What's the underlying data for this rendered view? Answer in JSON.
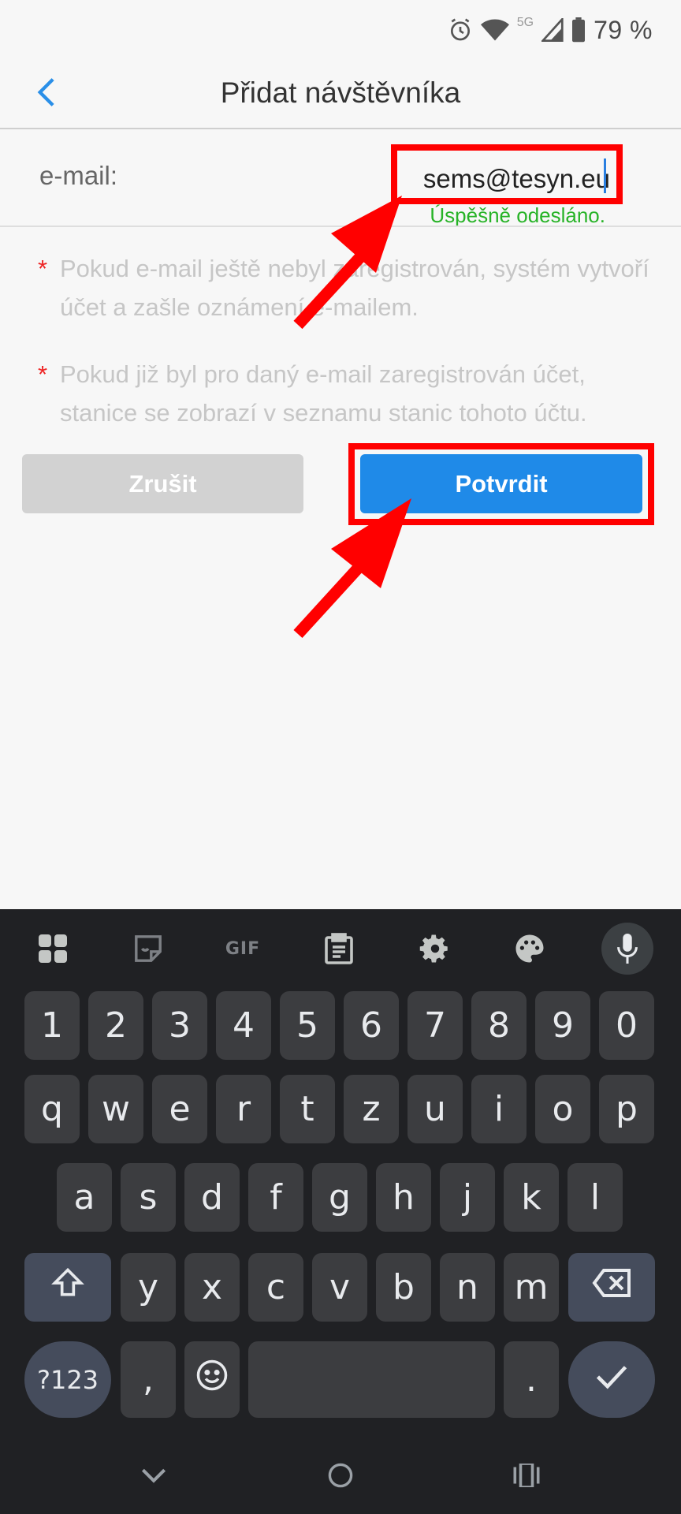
{
  "status_bar": {
    "battery": "79 %",
    "network": "5G"
  },
  "header": {
    "title": "Přidat návštěvníka"
  },
  "email": {
    "label": "e-mail:",
    "value": "sems@tesyn.eu",
    "success_message": "Úspěšně odesláno."
  },
  "notes": [
    {
      "marker": "*",
      "text": "Pokud e-mail ještě nebyl zaregistrován, systém vytvoří účet a zašle oznámení e-mailem."
    },
    {
      "marker": "*",
      "text": "Pokud již byl pro daný e-mail zaregistrován účet, stanice se zobrazí v seznamu stanic tohoto účtu."
    }
  ],
  "buttons": {
    "cancel": "Zrušit",
    "confirm": "Potvrdit"
  },
  "keyboard": {
    "toolbar_gif": "GIF",
    "row_numbers": [
      "1",
      "2",
      "3",
      "4",
      "5",
      "6",
      "7",
      "8",
      "9",
      "0"
    ],
    "row_1": [
      "q",
      "w",
      "e",
      "r",
      "t",
      "z",
      "u",
      "i",
      "o",
      "p"
    ],
    "row_2": [
      "a",
      "s",
      "d",
      "f",
      "g",
      "h",
      "j",
      "k",
      "l"
    ],
    "row_3": [
      "y",
      "x",
      "c",
      "v",
      "b",
      "n",
      "m"
    ],
    "symbols_key": "?123",
    "comma_key": ",",
    "period_key": "."
  },
  "colors": {
    "accent": "#1f8ae8",
    "annotation": "#ff0000",
    "success": "#27b327"
  }
}
